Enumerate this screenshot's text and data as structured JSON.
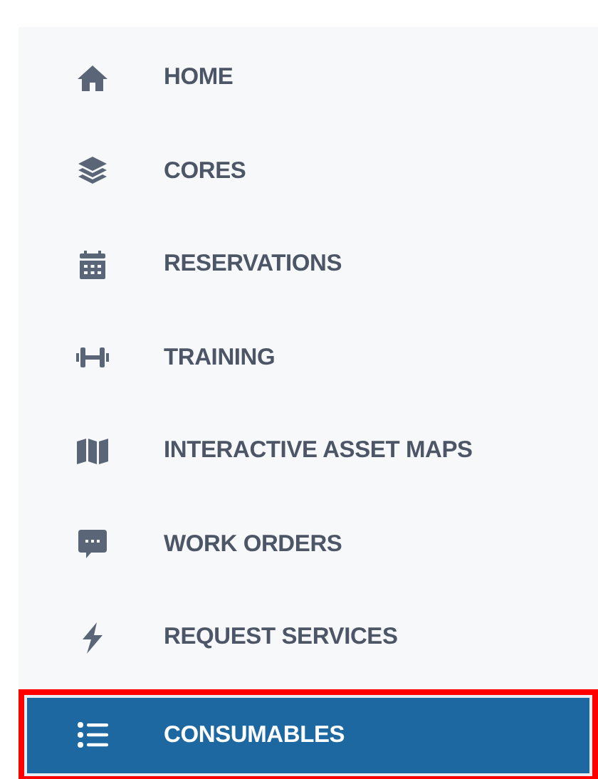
{
  "menu": [
    {
      "label": "HOME",
      "selected": false,
      "highlighted": false
    },
    {
      "label": "CORES",
      "selected": false,
      "highlighted": false
    },
    {
      "label": "RESERVATIONS",
      "selected": false,
      "highlighted": false
    },
    {
      "label": "TRAINING",
      "selected": false,
      "highlighted": false
    },
    {
      "label": "INTERACTIVE ASSET MAPS",
      "selected": false,
      "highlighted": false
    },
    {
      "label": "WORK ORDERS",
      "selected": false,
      "highlighted": false
    },
    {
      "label": "REQUEST SERVICES",
      "selected": false,
      "highlighted": false
    },
    {
      "label": "CONSUMABLES",
      "selected": true,
      "highlighted": true
    }
  ]
}
